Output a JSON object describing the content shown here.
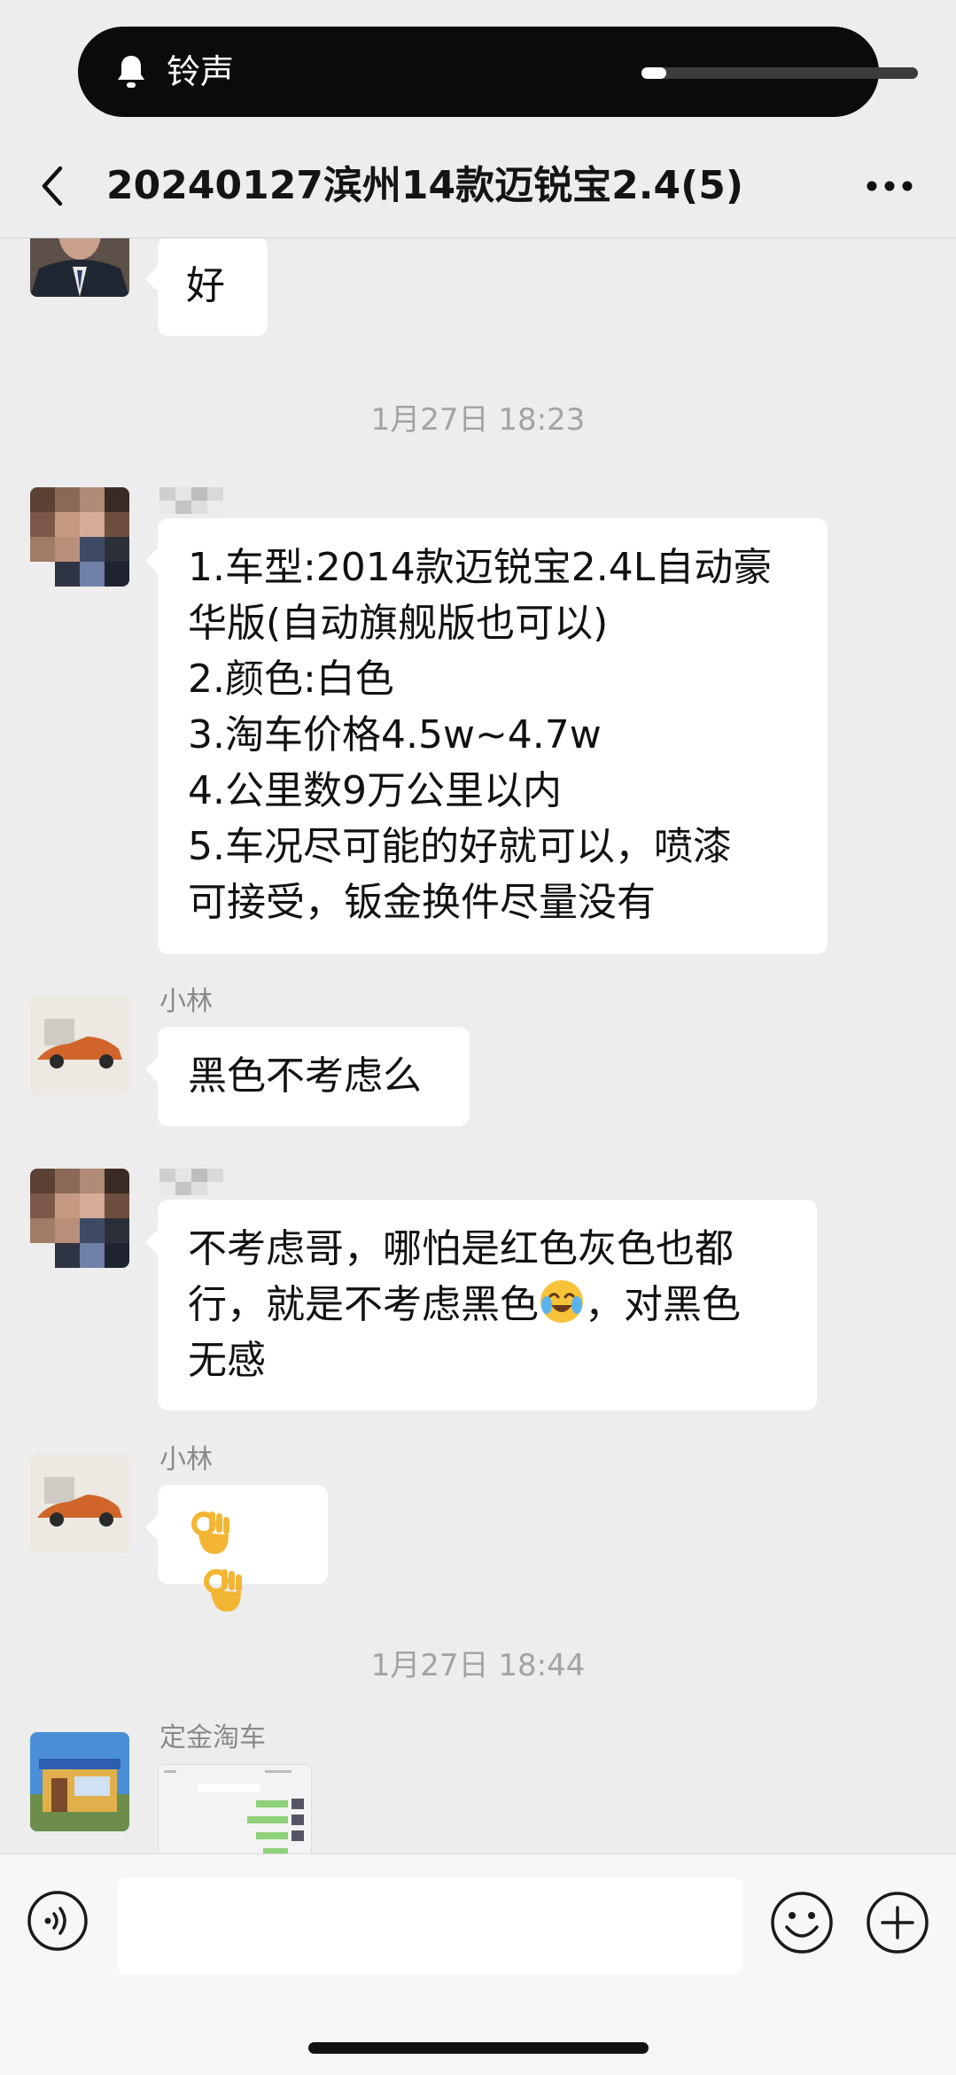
{
  "notification": {
    "label": "铃声",
    "volume_fraction": 0.09
  },
  "header": {
    "title": "20240127滨州14款迈锐宝2.4(5)"
  },
  "messages": {
    "m1": {
      "text": "好"
    },
    "t1": "1月27日 18:23",
    "m2": {
      "lines": [
        "1.车型:2014款迈锐宝2.4L自动豪",
        "华版(自动旗舰版也可以)",
        "2.颜色:白色",
        "3.淘车价格4.5w~4.7w",
        "4.公里数9万公里以内",
        "5.车况尽可能的好就可以，喷漆",
        "可接受，钣金换件尽量没有"
      ]
    },
    "m3": {
      "sender": "小林",
      "text": "黑色不考虑么"
    },
    "m4": {
      "lines": [
        "不考虑哥，哪怕是红色灰色也都",
        "行，就是不考虑黑色",
        "，对黑色",
        "无感"
      ],
      "emoji": "crying-laughing-emoji"
    },
    "m5": {
      "sender": "小林",
      "emojis": [
        "ok-hand-emoji",
        "ok-hand-emoji"
      ]
    },
    "t2": "1月27日 18:44",
    "m6": {
      "sender": "定金淘车",
      "content": "chat-screenshot-image"
    }
  },
  "colors": {
    "background": "#ededed",
    "bubble": "#ffffff",
    "pill": "#0b0b0b",
    "timestamp": "#a3a3a3"
  }
}
